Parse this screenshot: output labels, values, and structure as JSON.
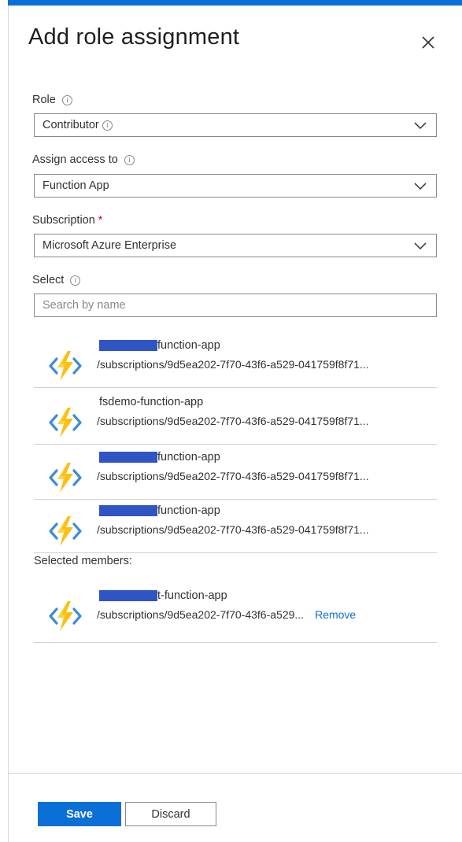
{
  "header": {
    "title": "Add role assignment"
  },
  "colors": {
    "accent": "#0a6fd6",
    "mask": "#2f55c5",
    "required": "#c50f1f"
  },
  "fields": {
    "role": {
      "label": "Role",
      "value": "Contributor"
    },
    "assign_access": {
      "label": "Assign access to",
      "value": "Function App"
    },
    "subscription": {
      "label": "Subscription",
      "required_mark": "*",
      "value": "Microsoft Azure Enterprise"
    },
    "select": {
      "label": "Select",
      "placeholder": "Search by name"
    }
  },
  "results": [
    {
      "name": "function-app",
      "path": "/subscriptions/9d5ea202-7f70-43f6-a529-041759f8f71...",
      "redacted": true
    },
    {
      "name": "fsdemo-function-app",
      "path": "/subscriptions/9d5ea202-7f70-43f6-a529-041759f8f71...",
      "redacted": false
    },
    {
      "name": "function-app",
      "path": "/subscriptions/9d5ea202-7f70-43f6-a529-041759f8f71...",
      "redacted": true
    },
    {
      "name": "function-app",
      "path": "/subscriptions/9d5ea202-7f70-43f6-a529-041759f8f71...",
      "redacted": true
    }
  ],
  "selected": {
    "label": "Selected members:",
    "items": [
      {
        "name": "t-function-app",
        "path": "/subscriptions/9d5ea202-7f70-43f6-a529...",
        "remove_label": "Remove"
      }
    ]
  },
  "footer": {
    "save_label": "Save",
    "discard_label": "Discard"
  },
  "icons": {
    "close": "close-icon",
    "chevron": "chevron-down-icon",
    "info": "info-icon",
    "function_app": "function-app-icon"
  }
}
